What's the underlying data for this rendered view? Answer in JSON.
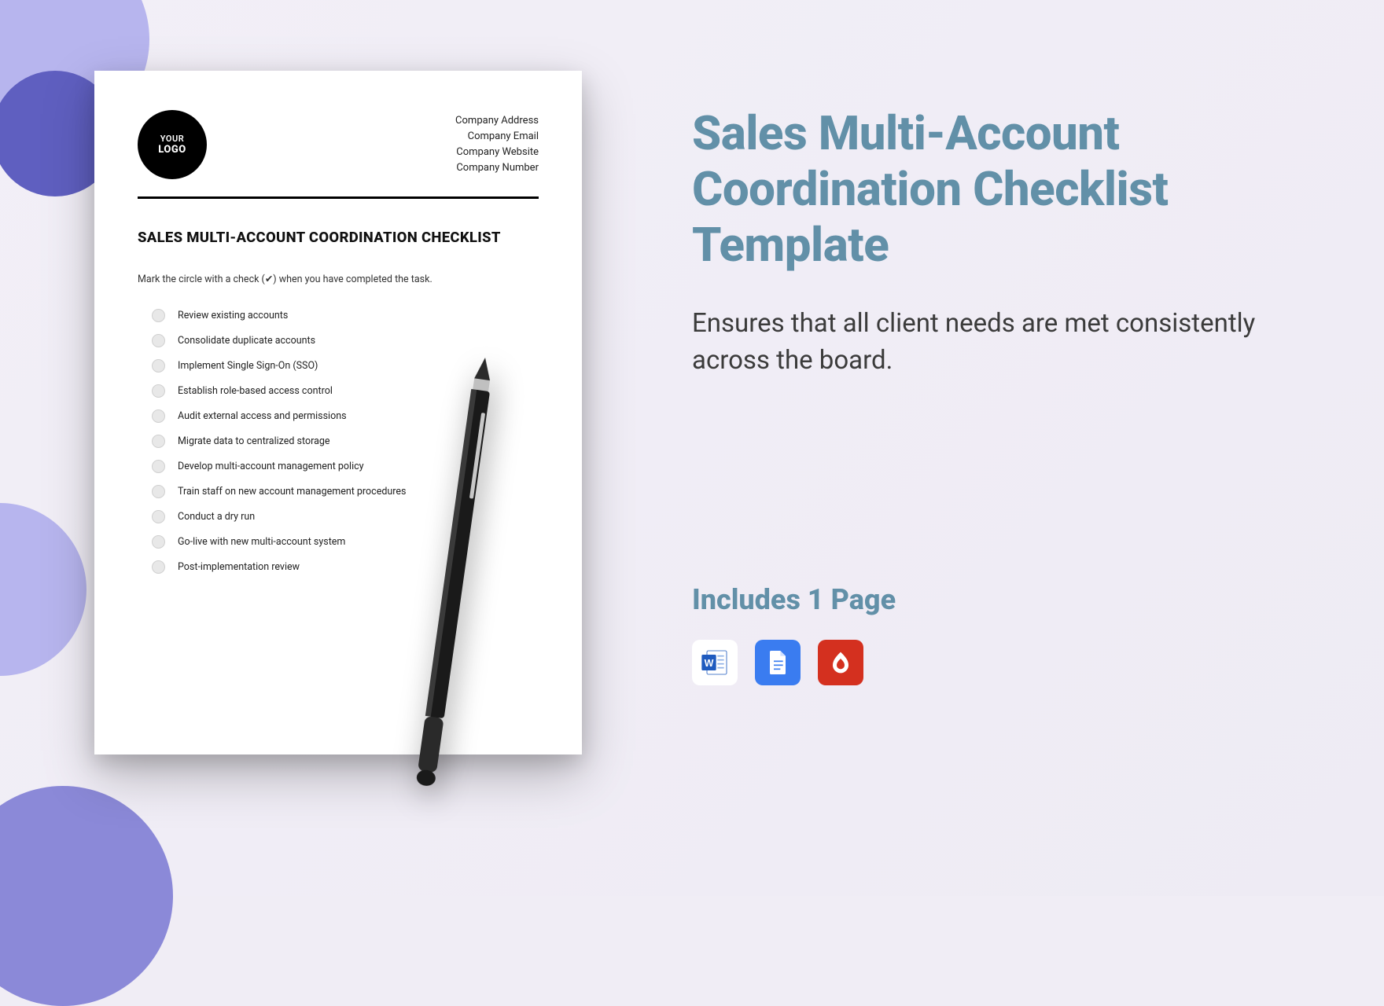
{
  "document": {
    "logo_line1": "YOUR",
    "logo_line2": "LOGO",
    "company_lines": [
      "Company Address",
      "Company Email",
      "Company Website",
      "Company Number"
    ],
    "doc_title": "SALES MULTI-ACCOUNT COORDINATION CHECKLIST",
    "instruction": "Mark the circle with a check (✔) when you have completed the task.",
    "checklist": [
      "Review existing accounts",
      "Consolidate duplicate accounts",
      "Implement Single Sign-On (SSO)",
      "Establish role-based access control",
      "Audit external access and permissions",
      "Migrate data to centralized storage",
      "Develop multi-account management policy",
      "Train staff on new account management procedures",
      "Conduct a dry run",
      "Go-live with new multi-account system",
      "Post-implementation review"
    ]
  },
  "promo": {
    "title": "Sales Multi-Account Coordination Checklist Template",
    "description": "Ensures that all client needs are met consistently across the board.",
    "includes_label": "Includes 1 Page",
    "file_formats": [
      "word",
      "google-docs",
      "pdf"
    ]
  },
  "colors": {
    "accent": "#6290a8",
    "lavender": "#b7b5ee",
    "violet": "#5f5fc0"
  }
}
